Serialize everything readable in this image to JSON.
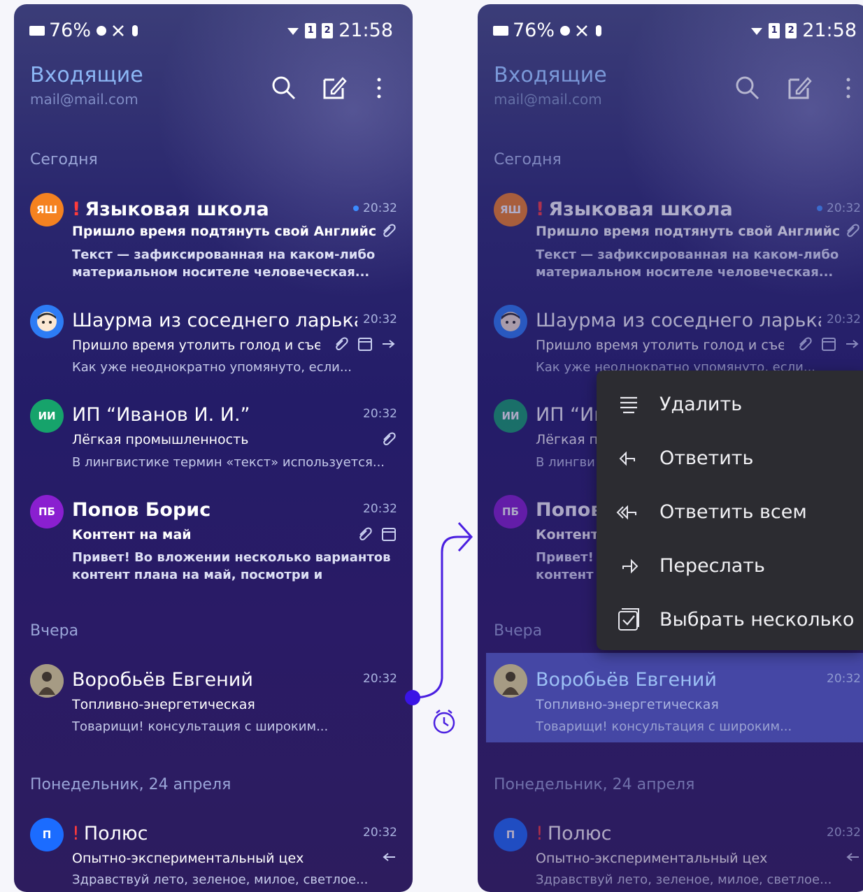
{
  "status": {
    "battery": "76%",
    "time": "21:58"
  },
  "header": {
    "title": "Входящие",
    "email": "mail@mail.com"
  },
  "sections": {
    "today": "Сегодня",
    "yesterday": "Вчера",
    "monday": "Понедельник, 24 апреля"
  },
  "emails": [
    {
      "initials": "ЯШ",
      "color": "#f58220",
      "important": "!",
      "sender": "Языковая школа",
      "time": "20:32",
      "subject": "Пришло время подтянуть свой Английский",
      "preview": "Текст — зафиксированная на каком-либо материальном носителе человеческая..."
    },
    {
      "initials": "",
      "color": "#2d7cf5",
      "sender": "Шаурма из соседнего ларька у",
      "time": "20:32",
      "subject": "Пришло время утолить голод и съесть",
      "preview": "Как уже неоднократно упомянуто, если..."
    },
    {
      "initials": "ИИ",
      "color": "#16a36b",
      "sender": "ИП “Иванов И. И.”",
      "time": "20:32",
      "subject": "Лёгкая промышленность",
      "preview": "В лингвистике термин «текст» используется..."
    },
    {
      "initials": "ПБ",
      "color": "#8a1fd0",
      "sender": "Попов Борис",
      "time": "20:32",
      "subject": "Контент на май",
      "preview": "Привет! Во вложении несколько вариантов контент плана на май, посмотри и выбери..."
    },
    {
      "initials": "",
      "color": "#8b7d6a",
      "sender": "Воробьёв Евгений",
      "time": "20:32",
      "subject": "Топливно-энергетическая",
      "preview": "Товарищи! консультация с широким..."
    },
    {
      "initials": "П",
      "color": "#1b6cff",
      "important": "!",
      "sender": "Полюс",
      "time": "20:32",
      "subject": "Опытно-экспериментальный цех",
      "preview": "Здравствуй лето, зеленое, милое, светлое..."
    }
  ],
  "right_truncated": {
    "ivanov": "ИП “Ив",
    "ivanov_subject": "Лёгкая п",
    "ivanov_preview": "В лингви",
    "popov": "Попов",
    "popov_subject": "Контент",
    "popov_preview": "Привет!",
    "popov_preview2": "контент"
  },
  "context_menu": {
    "items": [
      {
        "label": "Удалить",
        "icon": "delete-lines-icon"
      },
      {
        "label": "Ответить",
        "icon": "reply-icon"
      },
      {
        "label": "Ответить всем",
        "icon": "reply-all-icon"
      },
      {
        "label": "Переслать",
        "icon": "forward-icon"
      },
      {
        "label": "Выбрать несколько",
        "icon": "select-multiple-icon"
      }
    ]
  },
  "colors": {
    "accent": "#4a1fe0",
    "title": "#8cb7f5",
    "menu_bg": "#2c2c31"
  }
}
